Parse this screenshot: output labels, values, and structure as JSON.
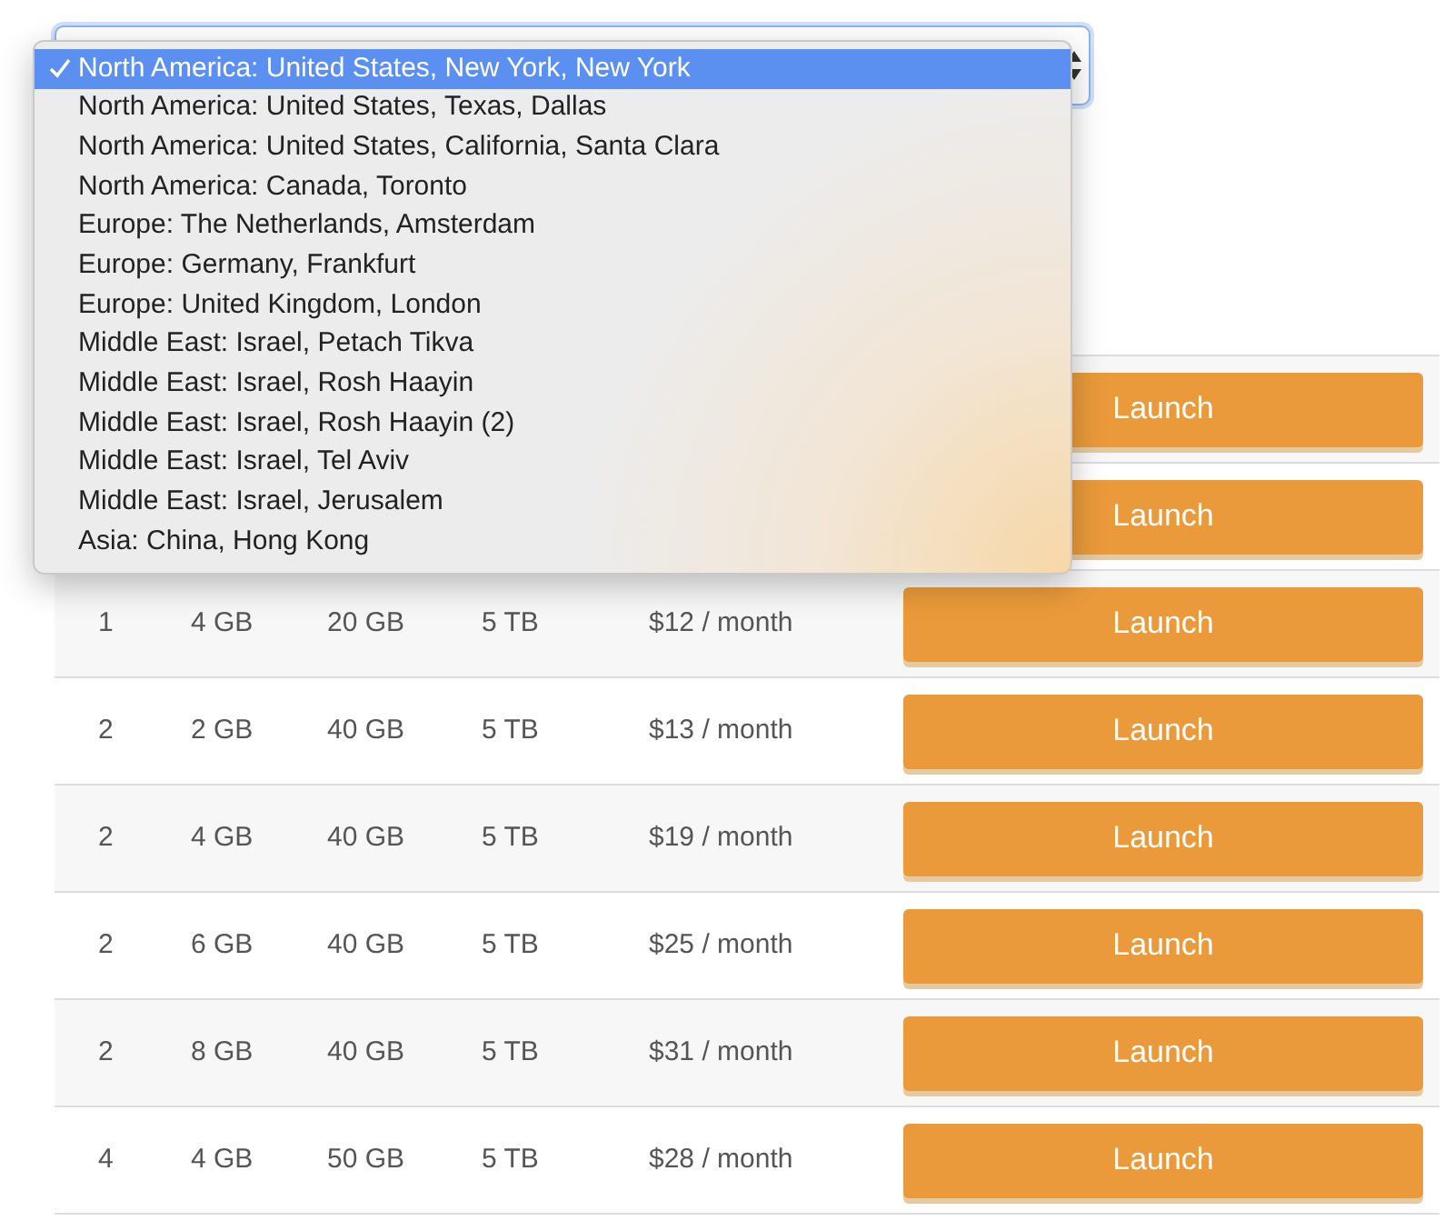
{
  "location_select": {
    "options": [
      {
        "label": "North America: United States, New York, New York",
        "selected": true
      },
      {
        "label": "North America: United States, Texas, Dallas",
        "selected": false
      },
      {
        "label": "North America: United States, California, Santa Clara",
        "selected": false
      },
      {
        "label": "North America: Canada, Toronto",
        "selected": false
      },
      {
        "label": "Europe: The Netherlands, Amsterdam",
        "selected": false
      },
      {
        "label": "Europe: Germany, Frankfurt",
        "selected": false
      },
      {
        "label": "Europe: United Kingdom, London",
        "selected": false
      },
      {
        "label": "Middle East: Israel, Petach Tikva",
        "selected": false
      },
      {
        "label": "Middle East: Israel, Rosh Haayin",
        "selected": false
      },
      {
        "label": "Middle East: Israel, Rosh Haayin (2)",
        "selected": false
      },
      {
        "label": "Middle East: Israel, Tel Aviv",
        "selected": false
      },
      {
        "label": "Middle East: Israel, Jerusalem",
        "selected": false
      },
      {
        "label": "Asia: China, Hong Kong",
        "selected": false
      }
    ]
  },
  "plans": {
    "rows": [
      {
        "button": "Launch"
      },
      {
        "button": "Launch"
      },
      {
        "cells": [
          "1",
          "4 GB",
          "20 GB",
          "5 TB",
          "$12 / month"
        ],
        "button": "Launch"
      },
      {
        "cells": [
          "2",
          "2 GB",
          "40 GB",
          "5 TB",
          "$13 / month"
        ],
        "button": "Launch"
      },
      {
        "cells": [
          "2",
          "4 GB",
          "40 GB",
          "5 TB",
          "$19 / month"
        ],
        "button": "Launch"
      },
      {
        "cells": [
          "2",
          "6 GB",
          "40 GB",
          "5 TB",
          "$25 / month"
        ],
        "button": "Launch"
      },
      {
        "cells": [
          "2",
          "8 GB",
          "40 GB",
          "5 TB",
          "$31 / month"
        ],
        "button": "Launch"
      },
      {
        "cells": [
          "4",
          "4 GB",
          "50 GB",
          "5 TB",
          "$28 / month"
        ],
        "button": "Launch"
      }
    ]
  }
}
